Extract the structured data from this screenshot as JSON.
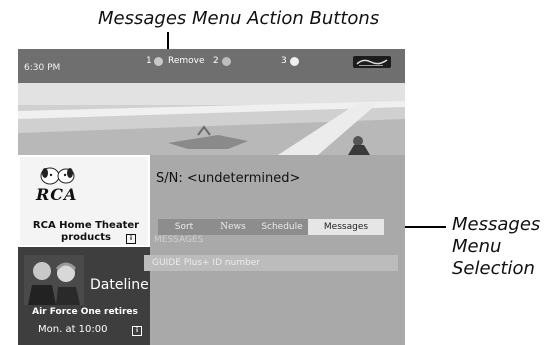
{
  "callouts": {
    "top": "Messages Menu Action Buttons",
    "right_lines": [
      "Messages",
      "Menu",
      "Selection"
    ]
  },
  "top_bar": {
    "clock": "6:30 PM",
    "actions": [
      {
        "number": "1",
        "label": "Remove"
      },
      {
        "number": "2",
        "label": ""
      },
      {
        "number": "3",
        "label": ""
      }
    ],
    "brand_icon": "guide-plus-logo"
  },
  "ads": {
    "ad1": {
      "logo": "RCA",
      "title_line1": "RCA Home Theater",
      "title_line2": "products",
      "icon": "info-icon"
    },
    "ad2": {
      "title": "Dateline",
      "subtitle": "Air Force One retires",
      "time": "Mon. at 10:00",
      "icon": "info-icon"
    }
  },
  "main": {
    "serial": "S/N: <undetermined>",
    "tabs": [
      "Sort",
      "News",
      "Schedule",
      "Messages"
    ],
    "selected_tab": "Messages",
    "section_heading": "MESSAGES",
    "rows": [
      "GUIDE Plus+ ID number"
    ]
  },
  "colors": {
    "screen_bg": "#a9a9a9",
    "top_bar": "#6f6f6f",
    "selected_tab": "#e6e6e6"
  }
}
